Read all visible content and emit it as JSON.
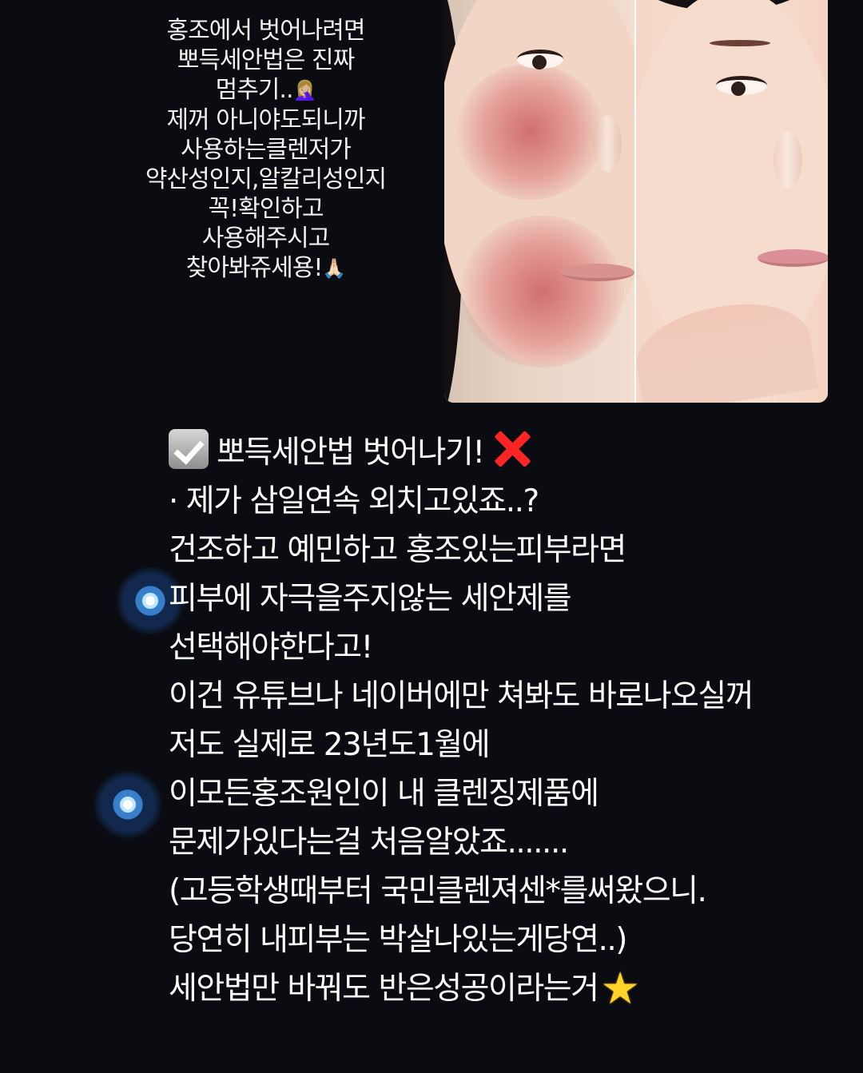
{
  "caption": {
    "lines": [
      "홍조에서 벗어나려면",
      "뽀득세안법은 진짜",
      "멈추기..",
      "제꺼 아니야도되니까",
      "사용하는클렌저가",
      "약산성인지,알칼리성인지",
      "꼭!확인하고",
      "사용해주시고",
      "찾아봐쥬세용!"
    ],
    "emoji_icons": [
      "person-facepalming-icon",
      "folded-hands-icon"
    ]
  },
  "images": {
    "before": "redness-face-photo",
    "after": "clear-face-photo"
  },
  "post": {
    "lines": [
      "뽀득세안법 벗어나기!",
      "· 제가 삼일연속 외치고있죠..?",
      "건조하고 예민하고 홍조있는피부라면",
      "피부에 자극을주지않는 세안제를",
      "선택해야한다고!",
      "이건 유튜브나 네이버에만 쳐봐도 바로나오실꺼",
      "저도 실제로 23년도1월에",
      "이모든홍조원인이 내 클렌징제품에",
      "문제가있다는걸 처음알았죠.......",
      "(고등학생때부터 국민클렌져센*를써왔으니.",
      "당연히 내피부는 박살나있는게당연..)",
      "세안법만 바꿔도 반은성공이라는거"
    ],
    "icons": [
      "checked-box-icon",
      "red-cross-icon",
      "glowing-bullet-icon",
      "star-icon"
    ]
  },
  "colors": {
    "background": "#0b0c12",
    "text": "#ffffff",
    "accent_red": "#ff2525",
    "accent_yellow": "#ffd329",
    "glow_blue": "#46a0ff"
  }
}
